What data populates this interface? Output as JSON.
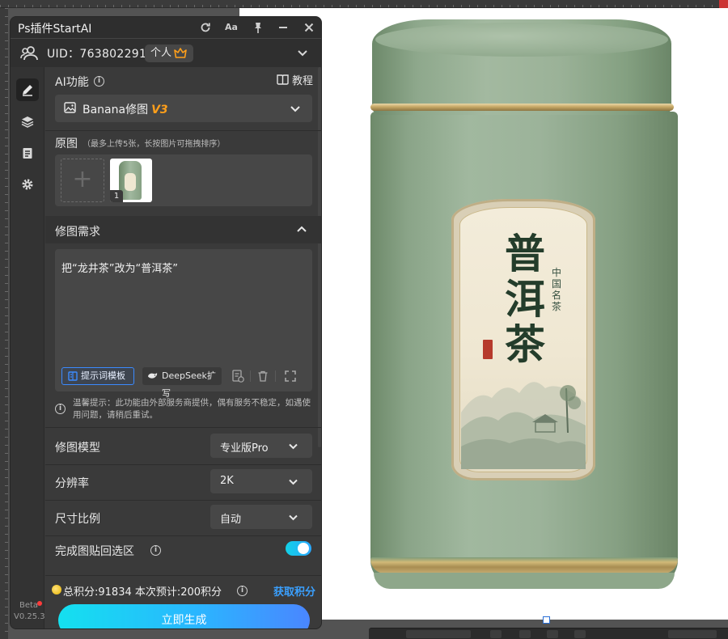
{
  "panel": {
    "title": "Ps插件StartAI",
    "titlebar_buttons": {
      "font": "Aa"
    }
  },
  "user": {
    "uid": "UID：763802291",
    "badge": "个人"
  },
  "sidebar": {
    "items": [
      {
        "name": "edit",
        "icon": "pencil-icon"
      },
      {
        "name": "layers",
        "icon": "layers-icon"
      },
      {
        "name": "clipboard",
        "icon": "clipboard-icon"
      },
      {
        "name": "settings",
        "icon": "gear-icon"
      }
    ],
    "beta": "Beta",
    "version": "V0.25.3"
  },
  "ai_function": {
    "label": "AI功能",
    "tutorial": "教程",
    "selected": "Banana修图",
    "selected_tag": "V3"
  },
  "source": {
    "label": "原图",
    "hint": "（最多上传5张，长按图片可拖拽排序）",
    "images": [
      {
        "index": "1"
      }
    ]
  },
  "requirement": {
    "label": "修图需求",
    "text": "把“龙井茶”改为“普洱茶”",
    "template_button": "提示词模板",
    "deepseek_button": "DeepSeek扩写"
  },
  "notice": "温馨提示：此功能由外部服务商提供，偶有服务不稳定，如遇使用问题，请稍后重试。",
  "settings": {
    "model": {
      "label": "修图模型",
      "value": "专业版Pro"
    },
    "resolution": {
      "label": "分辨率",
      "value": "2K"
    },
    "ratio": {
      "label": "尺寸比例",
      "value": "自动"
    },
    "paste_back": {
      "label": "完成图贴回选区",
      "enabled": true
    }
  },
  "footer": {
    "points": "总积分:91834  本次预计:200积分",
    "get_points": "获取积分",
    "generate": "立即生成"
  },
  "canvas_image": {
    "title": "普洱茶",
    "subtitle": "中国名茶"
  },
  "colors": {
    "accent": "#2aa8ff",
    "tag_orange": "#ff9f1a",
    "can_green": "#9cb39a"
  }
}
